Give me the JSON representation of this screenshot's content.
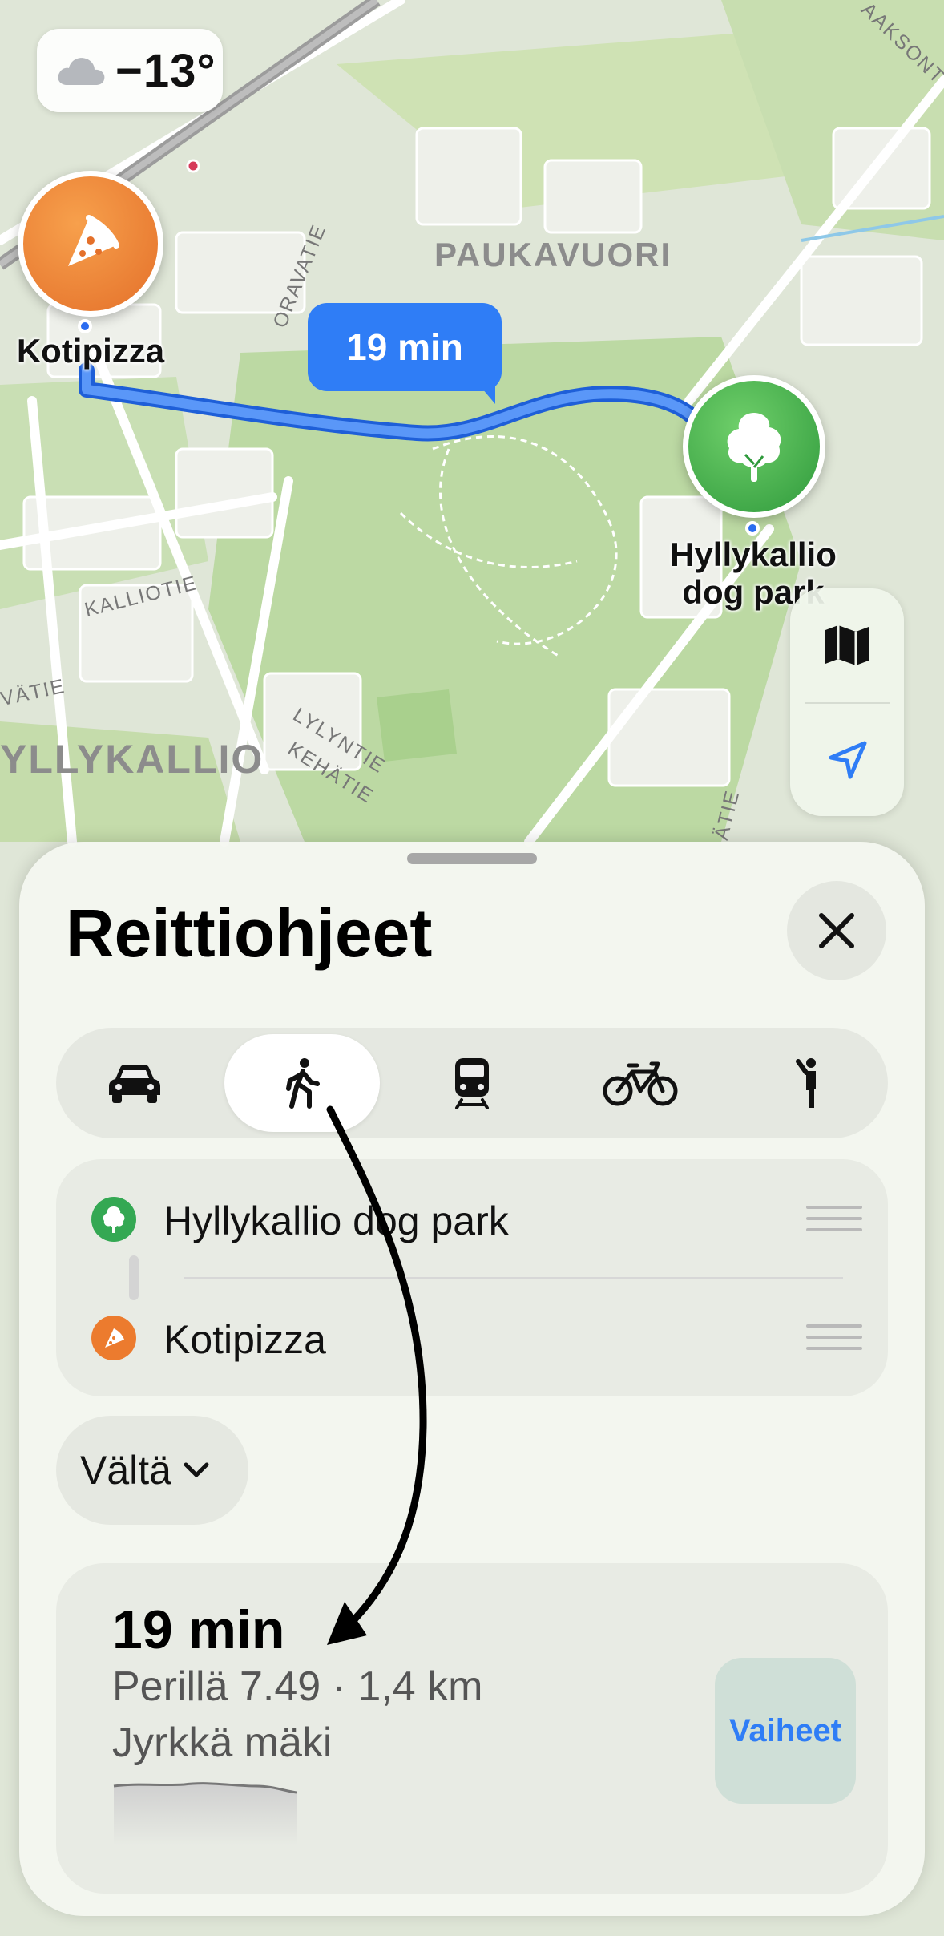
{
  "weather": {
    "temperature": "−13°",
    "icon": "cloud-icon"
  },
  "map": {
    "area_labels": [
      "PAUKAVUORI",
      "YLLYKALLIO"
    ],
    "street_labels": [
      "ORAVATIE",
      "KALLIOTIE",
      "VÄTIE",
      "LYLYNTIE",
      "KEHÄTIE",
      "ÄTIE",
      "AAKSONT"
    ],
    "route_eta": "19 min",
    "start_pin": {
      "label": "Kotipizza",
      "icon": "pizza-icon"
    },
    "end_pin": {
      "label_line1": "Hyllykallio",
      "label_line2": "dog park",
      "icon": "tree-icon"
    },
    "controls": [
      "map-icon",
      "location-arrow-icon"
    ]
  },
  "sheet": {
    "title": "Reittiohjeet",
    "close_icon": "close-icon",
    "modes": [
      {
        "icon": "car-icon",
        "active": false
      },
      {
        "icon": "walk-icon",
        "active": true
      },
      {
        "icon": "train-icon",
        "active": false
      },
      {
        "icon": "bicycle-icon",
        "active": false
      },
      {
        "icon": "rideshare-icon",
        "active": false
      }
    ],
    "stops": [
      {
        "name": "Hyllykallio dog park",
        "icon": "tree-icon",
        "color": "#34a853"
      },
      {
        "name": "Kotipizza",
        "icon": "pizza-icon",
        "color": "#ec7b2e"
      }
    ],
    "avoid_label": "Vältä",
    "route": {
      "time": "19 min",
      "arrival": "Perillä 7.49 · 1,4 km",
      "note": "Jyrkkä mäki",
      "steps_label": "Vaiheet"
    }
  },
  "colors": {
    "accent": "#2f7df6",
    "park_green": "#34a853",
    "pizza_orange": "#ec7b2e"
  }
}
